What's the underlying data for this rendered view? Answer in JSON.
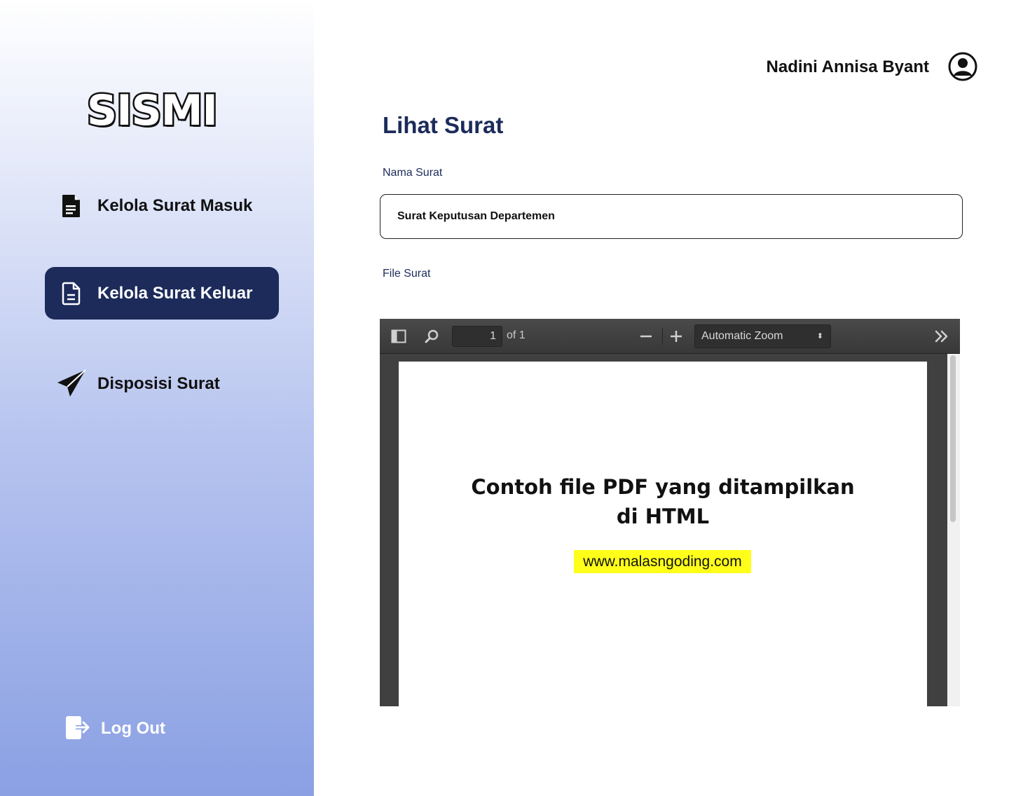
{
  "app": {
    "logo_text": "SISMI"
  },
  "sidebar": {
    "items": [
      {
        "label": "Kelola Surat Masuk",
        "icon": "file-text-icon",
        "active": false
      },
      {
        "label": "Kelola Surat  Keluar",
        "icon": "file-outline-icon",
        "active": true
      },
      {
        "label": "Disposisi Surat",
        "icon": "paper-plane-icon",
        "active": false
      }
    ],
    "logout_label": "Log Out"
  },
  "header": {
    "user_name": "Nadini Annisa Byant",
    "avatar_icon": "user-circle-icon"
  },
  "main": {
    "title": "Lihat Surat",
    "nama_surat_label": "Nama Surat",
    "nama_surat_value": "Surat Keputusan Departemen",
    "file_surat_label": "File Surat"
  },
  "pdf_viewer": {
    "page_current": "1",
    "page_of": "of 1",
    "zoom_label": "Automatic Zoom",
    "content_heading_line1": "Contoh file PDF yang ditampilkan",
    "content_heading_line2": "di HTML",
    "content_link": "www.malasngoding.com"
  },
  "colors": {
    "accent": "#1c2b5a",
    "highlight": "#ffff1a",
    "viewer_bg": "#404040"
  }
}
